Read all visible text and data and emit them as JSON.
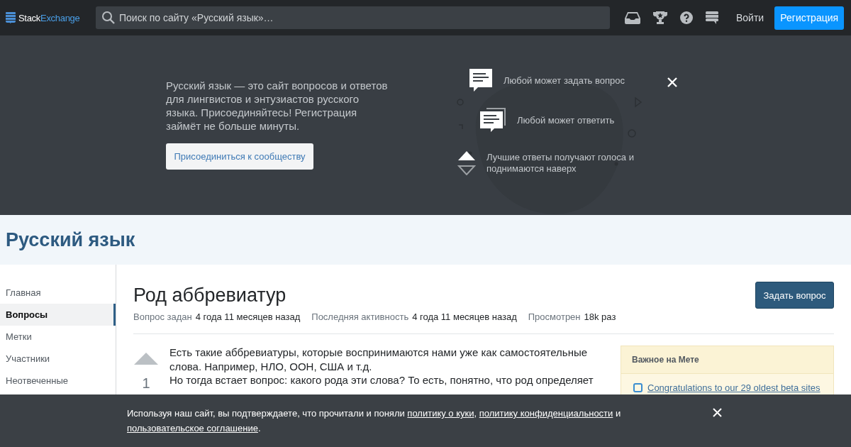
{
  "topbar": {
    "logo": {
      "first": "Stack",
      "second": "Exchange"
    },
    "search": {
      "placeholder": "Поиск по сайту «Русский язык»…"
    },
    "login": "Войти",
    "signup": "Регистрация"
  },
  "hero": {
    "text": "Русский язык — это сайт вопросов и ответов для лингвистов и энтузиастов русского языка. Присоединяйтесь! Регистрация займёт не больше минуты.",
    "join": "Присоединиться к сообществу",
    "features": [
      {
        "kind": "ask",
        "text": "Любой может задать вопрос"
      },
      {
        "kind": "answer",
        "text": "Любой может ответить"
      },
      {
        "kind": "vote",
        "text": "Лучшие ответы получают голоса и поднимаются наверх"
      }
    ]
  },
  "site_title": "Русский язык",
  "sidebar": {
    "items": [
      {
        "label": "Главная",
        "selected": false
      },
      {
        "label": "Вопросы",
        "selected": true
      },
      {
        "label": "Метки",
        "selected": false
      },
      {
        "label": "Участники",
        "selected": false
      },
      {
        "label": "Неотвеченные",
        "selected": false
      }
    ]
  },
  "question": {
    "title": "Род аббревиатур",
    "ask_button": "Задать вопрос",
    "meta": [
      {
        "label": "Вопрос задан",
        "value": "4 года 11 месяцев назад"
      },
      {
        "label": "Последняя активность",
        "value": "4 года 11 месяцев назад"
      },
      {
        "label": "Просмотрен",
        "value": "18k раз"
      }
    ],
    "votes": "1",
    "body": [
      "Есть такие аббревиатуры, которые воспринимаются нами уже как самостоятельные слова. Например, НЛО, ООН, США и т.д.",
      "Но тогда встает вопрос: какого рода эти слова? То есть, понятно, что род определяет"
    ]
  },
  "meta_box": {
    "title": "Важное на Мете",
    "items": [
      "Congratulations to our 29 oldest beta sites"
    ]
  },
  "cookie": {
    "parts": [
      {
        "kind": "text",
        "text": "Используя наш сайт, вы подтверждаете, что прочитали и поняли "
      },
      {
        "kind": "link",
        "text": "политику о куки"
      },
      {
        "kind": "text",
        "text": ", "
      },
      {
        "kind": "link",
        "text": "политику конфиденциальности"
      },
      {
        "kind": "text",
        "text": " и "
      },
      {
        "kind": "link",
        "text": "пользовательское соглашение"
      },
      {
        "kind": "text",
        "text": "."
      }
    ]
  }
}
